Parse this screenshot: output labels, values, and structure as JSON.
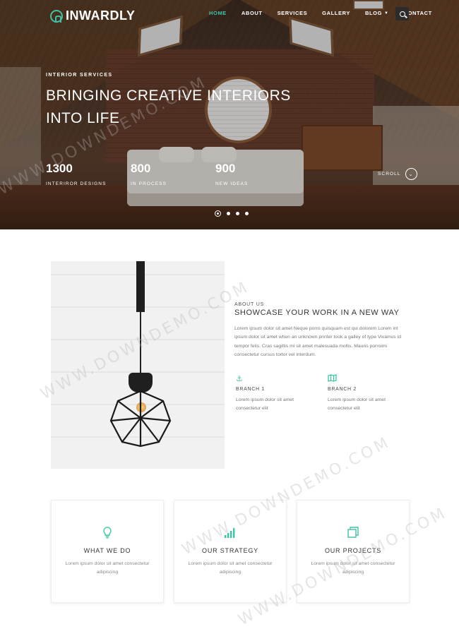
{
  "brand": {
    "name": "INWARDLY",
    "accent": "#3ec3a6"
  },
  "nav": {
    "items": [
      {
        "label": "HOME",
        "active": true
      },
      {
        "label": "ABOUT"
      },
      {
        "label": "SERVICES"
      },
      {
        "label": "GALLERY"
      },
      {
        "label": "BLOG",
        "dropdown": true
      },
      {
        "label": "CONTACT"
      }
    ],
    "search_icon": "search-icon"
  },
  "hero": {
    "subtitle": "INTERIOR SERVICES",
    "title_line1": "BRINGING CREATIVE INTERIORS",
    "title_line2": "INTO LIFE",
    "stats": [
      {
        "value": "1300",
        "label": "INTERIROR DESIGNS"
      },
      {
        "value": "800",
        "label": "IN PROCESS"
      },
      {
        "value": "900",
        "label": "NEW IDEAS"
      }
    ],
    "scroll_label": "SCROLL",
    "slider_dots": 4,
    "active_dot": 1
  },
  "about": {
    "subtitle": "ABOUT US",
    "title": "SHOWCASE YOUR WORK IN A NEW WAY",
    "text": "Lorem ipsum dolor sit amet Neque porro quisquam est qui dolorem Lorem int ipsum dolor sit amet when an unknown printer took a galley of type Vivamus id tempor felis. Cras sagittis mi sit amet malesuada mollis. Mauris porroimi consectetur cursus tortor vel interdum.",
    "branches": [
      {
        "icon": "anchor-icon",
        "title": "BRANCH 1",
        "text": "Lorem ipsum dolor sit amet consectetur elit"
      },
      {
        "icon": "map-icon",
        "title": "BRANCH 2",
        "text": "Lorem ipsum dolor sit amet consectetur elit"
      }
    ]
  },
  "features": [
    {
      "icon": "lightbulb-icon",
      "title": "WHAT WE DO",
      "text": "Lorem ipsum dolor sit amet consectetur adipiscing"
    },
    {
      "icon": "bar-chart-icon",
      "title": "OUR STRATEGY",
      "text": "Lorem ipsum dolor sit amet consectetur adipiscing"
    },
    {
      "icon": "copy-icon",
      "title": "OUR PROJECTS",
      "text": "Lorem ipsum dolor sit amet consectetur adipiscing"
    }
  ],
  "watermark": "WWW.DOWNDEMO.COM"
}
